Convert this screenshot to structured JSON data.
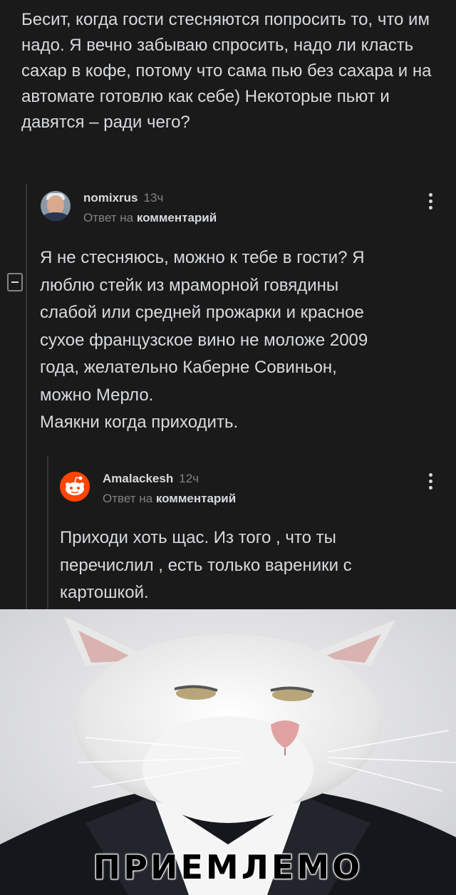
{
  "parent_comment": {
    "text": "Бесит, когда гости стесняются попросить то, что им надо. Я вечно забываю спросить, надо ли класть сахар в кофе, потому что сама пью без сахара и на автомате готовлю как себе) Некоторые пьют и давятся – ради чего?"
  },
  "reply1": {
    "username": "nomixrus",
    "time": "13ч",
    "reply_prefix": "Ответ на",
    "reply_target": "комментарий",
    "lines": [
      "Я не стесняюсь, можно к тебе в гости? Я",
      "люблю стейк из мраморной говядины",
      "слабой или средней прожарки и красное",
      "сухое французское вино не моложе 2009",
      "года, желательно Каберне Совиньон,",
      "можно Мерло.",
      "Маякни когда приходить."
    ]
  },
  "reply2": {
    "username": "Amalackesh",
    "time": "12ч",
    "reply_prefix": "Ответ на",
    "reply_target": "комментарий",
    "lines": [
      "Приходи хоть щас. Из того , что ты",
      "перечислил , есть только вареники с",
      "картошкой."
    ]
  },
  "meme": {
    "caption": "ПРИЕМЛЕМО"
  },
  "colors": {
    "background": "#1a1a1b",
    "text": "#d7dadc",
    "muted": "#818384",
    "reddit_orange": "#ff4500"
  }
}
